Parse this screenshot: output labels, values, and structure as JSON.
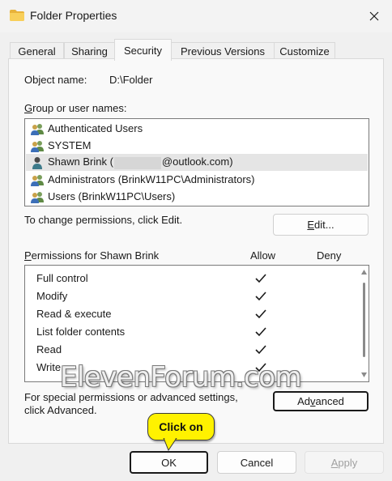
{
  "window": {
    "title": "Folder Properties"
  },
  "tabs": [
    {
      "label": "General"
    },
    {
      "label": "Sharing"
    },
    {
      "label": "Security",
      "active": true
    },
    {
      "label": "Previous Versions"
    },
    {
      "label": "Customize"
    }
  ],
  "object": {
    "label": "Object name:",
    "value": "D:\\Folder"
  },
  "groups": {
    "label_key": "G",
    "label_rest": "roup or user names:",
    "items": [
      {
        "name": "Authenticated Users",
        "icon": "users-group-icon"
      },
      {
        "name": "SYSTEM",
        "icon": "users-group-icon"
      },
      {
        "name_prefix": "Shawn Brink (",
        "name_suffix": "@outlook.com)",
        "icon": "user-icon",
        "selected": true
      },
      {
        "name": "Administrators (BrinkW11PC\\Administrators)",
        "icon": "users-group-icon"
      },
      {
        "name": "Users (BrinkW11PC\\Users)",
        "icon": "users-group-icon"
      }
    ]
  },
  "change_text": "To change permissions, click Edit.",
  "edit_button": {
    "key": "E",
    "rest": "dit..."
  },
  "permissions": {
    "label_key": "P",
    "label_rest": "ermissions for Shawn Brink",
    "allow_header": "Allow",
    "deny_header": "Deny",
    "rows": [
      {
        "name": "Full control",
        "allow": true,
        "deny": false
      },
      {
        "name": "Modify",
        "allow": true,
        "deny": false
      },
      {
        "name": "Read & execute",
        "allow": true,
        "deny": false
      },
      {
        "name": "List folder contents",
        "allow": true,
        "deny": false
      },
      {
        "name": "Read",
        "allow": true,
        "deny": false
      },
      {
        "name": "Write",
        "allow": true,
        "deny": false
      }
    ]
  },
  "special": {
    "line1": "For special permissions or advanced settings,",
    "line2": "click Advanced."
  },
  "advanced_button": {
    "pre": "Ad",
    "key": "v",
    "rest": "anced"
  },
  "footer": {
    "ok": "OK",
    "cancel": "Cancel",
    "apply_key": "A",
    "apply_rest": "pply"
  },
  "watermark": "ElevenForum.com",
  "callout": {
    "text": "Click on",
    "color": "#fff200"
  },
  "colors": {
    "selection": "#e5e5e5",
    "focus_border": "#1a1a1a"
  }
}
